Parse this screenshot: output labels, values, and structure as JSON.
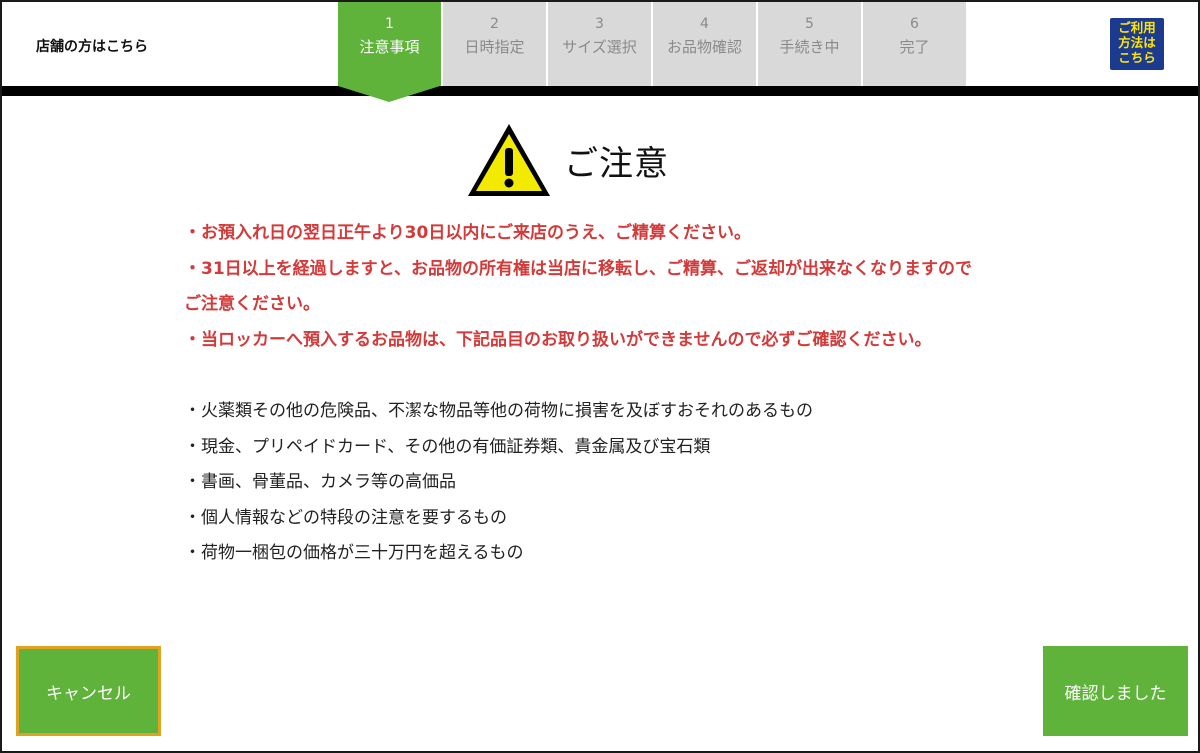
{
  "header": {
    "store_link": "店舗の方はこちら",
    "help_icon": {
      "name": "help-guide-icon",
      "lines": [
        "ご利用",
        "方法は",
        "こちら"
      ]
    },
    "steps": [
      {
        "num": "1",
        "label": "注意事項",
        "active": true
      },
      {
        "num": "2",
        "label": "日時指定",
        "active": false
      },
      {
        "num": "3",
        "label": "サイズ選択",
        "active": false
      },
      {
        "num": "4",
        "label": "お品物確認",
        "active": false
      },
      {
        "num": "5",
        "label": "手続き中",
        "active": false
      },
      {
        "num": "6",
        "label": "完了",
        "active": false
      }
    ]
  },
  "notice": {
    "icon": "warning-triangle-icon",
    "title": "ご注意",
    "warnings": [
      "・お預入れ日の翌日正午より30日以内にご来店のうえ、ご精算ください。",
      "・31日以上を経過しますと、お品物の所有権は当店に移転し、ご精算、ご返却が出来なくなりますので",
      "ご注意ください。",
      "・当ロッカーへ預入するお品物は、下記品目のお取り扱いができませんので必ずご確認ください。"
    ],
    "prohibited_items": [
      "・火薬類その他の危険品、不潔な物品等他の荷物に損害を及ぼすおそれのあるもの",
      "・現金、プリペイドカード、その他の有価証券類、貴金属及び宝石類",
      "・書画、骨董品、カメラ等の高価品",
      "・個人情報などの特段の注意を要するもの",
      "・荷物一梱包の価格が三十万円を超えるもの"
    ]
  },
  "actions": {
    "cancel_label": "キャンセル",
    "confirm_label": "確認しました"
  },
  "colors": {
    "accent_green": "#5fb33b",
    "warning_red": "#d33a3a",
    "step_inactive": "#d9d9d9",
    "help_bg": "#1c3a8f",
    "help_text": "#ffe600",
    "cancel_border": "#e0a321"
  }
}
